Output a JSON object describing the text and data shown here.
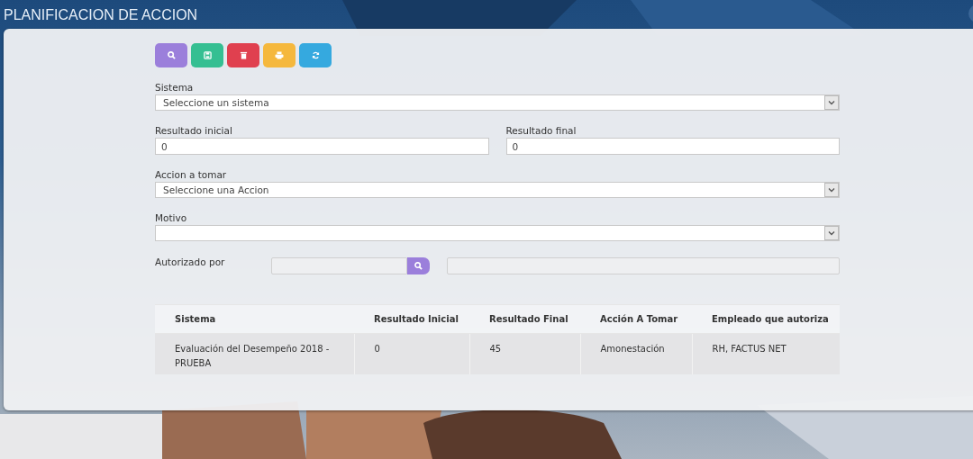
{
  "window": {
    "title": "PLANIFICACION DE ACCION"
  },
  "toolbar": [
    {
      "kind": "search",
      "color": "#9b7fdb"
    },
    {
      "kind": "save",
      "color": "#35bf92"
    },
    {
      "kind": "delete",
      "color": "#e0404f"
    },
    {
      "kind": "print",
      "color": "#f5b83d"
    },
    {
      "kind": "refresh",
      "color": "#35a9df"
    }
  ],
  "form": {
    "sistema": {
      "label": "Sistema",
      "value": "Seleccione un sistema"
    },
    "resultado_inicial": {
      "label": "Resultado inicial",
      "value": "0"
    },
    "resultado_final": {
      "label": "Resultado final",
      "value": "0"
    },
    "accion": {
      "label": "Accion a tomar",
      "value": "Seleccione una Accion"
    },
    "motivo": {
      "label": "Motivo"
    },
    "autorizado_por": {
      "label": "Autorizado por"
    }
  },
  "table": {
    "columns": [
      "Sistema",
      "Resultado Inicial",
      "Resultado Final",
      "Acción A Tomar",
      "Empleado que autoriza"
    ],
    "rows": [
      [
        "Evaluación del Desempeño 2018 - PRUEBA",
        "0",
        "45",
        "Amonestación",
        "RH, FACTUS NET"
      ]
    ]
  }
}
